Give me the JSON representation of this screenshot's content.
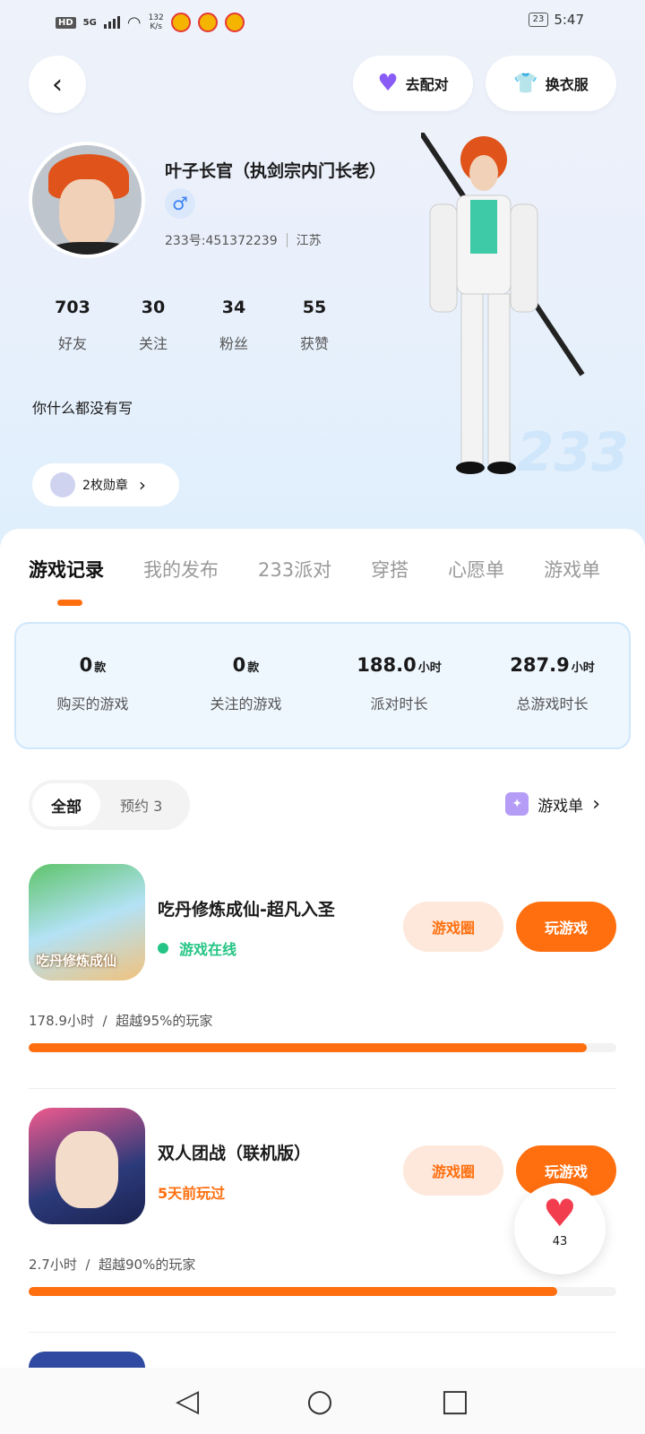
{
  "status_bar": {
    "hd": "HD",
    "network": "5G",
    "speed_top": "132",
    "speed_unit": "K/s",
    "battery": "23",
    "time": "5:47"
  },
  "header": {
    "back_icon": "chevron-left-icon",
    "pair_label": "去配对",
    "dress_label": "换衣服"
  },
  "profile": {
    "name": "叶子长官（执剑宗内门长老）",
    "gender_symbol": "♂",
    "id_text": "233号:451372239",
    "location": "江苏",
    "stats": [
      {
        "value": "703",
        "label": "好友"
      },
      {
        "value": "30",
        "label": "关注"
      },
      {
        "value": "34",
        "label": "粉丝"
      },
      {
        "value": "55",
        "label": "获赞"
      }
    ],
    "bio": "你什么都没有写",
    "medal_label": "2枚勋章",
    "badge_233": "233"
  },
  "tabs": [
    "游戏记录",
    "我的发布",
    "233派对",
    "穿搭",
    "心愿单",
    "游戏单"
  ],
  "summary": [
    {
      "value": "0",
      "unit": "款",
      "label": "购买的游戏"
    },
    {
      "value": "0",
      "unit": "款",
      "label": "关注的游戏"
    },
    {
      "value": "188.0",
      "unit": "小时",
      "label": "派对时长"
    },
    {
      "value": "287.9",
      "unit": "小时",
      "label": "总游戏时长"
    }
  ],
  "filter": {
    "all": "全部",
    "reserve": "预约",
    "reserve_count": "3",
    "gamelist": "游戏单"
  },
  "games": [
    {
      "name": "吃丹修炼成仙-超凡入圣",
      "status": "游戏在线",
      "status_color": "#24c584",
      "circle_btn": "游戏圈",
      "play_btn": "玩游戏",
      "time": "178.9小时",
      "rank": "超越95%的玩家",
      "progress": 0.95,
      "icon_text": "吃丹修炼成仙"
    },
    {
      "name": "双人团战（联机版）",
      "status": "5天前玩过",
      "status_color": "#ff6f0f",
      "circle_btn": "游戏圈",
      "play_btn": "玩游戏",
      "time": "2.7小时",
      "rank": "超越90%的玩家",
      "progress": 0.9
    }
  ],
  "like": {
    "count": "43"
  }
}
